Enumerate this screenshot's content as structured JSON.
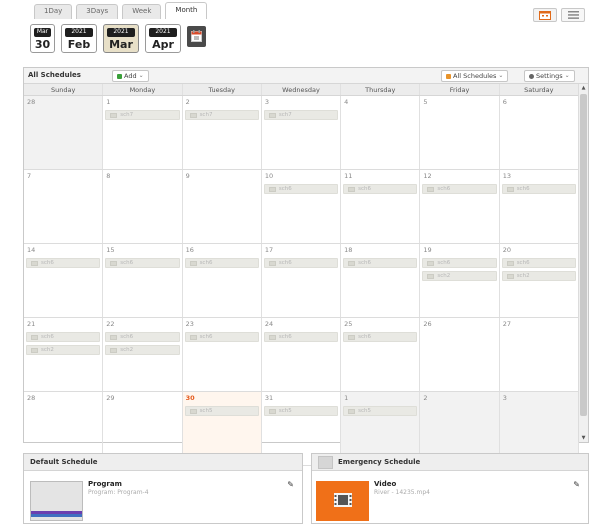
{
  "view_tabs": [
    "1Day",
    "3Days",
    "Week",
    "Month"
  ],
  "active_view": "Month",
  "view_icons": [
    "calendar-view-icon",
    "list-view-icon"
  ],
  "month_nav": [
    {
      "top": "Mar",
      "bottom": "30",
      "kind": "today"
    },
    {
      "top": "2021",
      "bottom": "Feb"
    },
    {
      "top": "2021",
      "bottom": "Mar",
      "selected": true
    },
    {
      "top": "2021",
      "bottom": "Apr"
    }
  ],
  "toolbar": {
    "title": "All Schedules",
    "add_label": "Add",
    "filter_label": "All Schedules",
    "settings_label": "Settings"
  },
  "weekdays": [
    "Sunday",
    "Monday",
    "Tuesday",
    "Wednesday",
    "Thursday",
    "Friday",
    "Saturday"
  ],
  "weeks": [
    [
      {
        "day": "28",
        "gray": true,
        "events": []
      },
      {
        "day": "1",
        "events": [
          "sch7"
        ]
      },
      {
        "day": "2",
        "events": [
          "sch7"
        ]
      },
      {
        "day": "3",
        "events": [
          "sch7"
        ]
      },
      {
        "day": "4",
        "events": []
      },
      {
        "day": "5",
        "events": []
      },
      {
        "day": "6",
        "events": []
      }
    ],
    [
      {
        "day": "7",
        "events": []
      },
      {
        "day": "8",
        "events": []
      },
      {
        "day": "9",
        "events": []
      },
      {
        "day": "10",
        "events": [
          "sch6"
        ]
      },
      {
        "day": "11",
        "events": [
          "sch6"
        ]
      },
      {
        "day": "12",
        "events": [
          "sch6"
        ]
      },
      {
        "day": "13",
        "events": [
          "sch6"
        ]
      }
    ],
    [
      {
        "day": "14",
        "events": [
          "sch6"
        ]
      },
      {
        "day": "15",
        "events": [
          "sch6"
        ]
      },
      {
        "day": "16",
        "events": [
          "sch6"
        ]
      },
      {
        "day": "17",
        "events": [
          "sch6"
        ]
      },
      {
        "day": "18",
        "events": [
          "sch6"
        ]
      },
      {
        "day": "19",
        "events": [
          "sch6",
          "sch2"
        ]
      },
      {
        "day": "20",
        "events": [
          "sch6",
          "sch2"
        ]
      }
    ],
    [
      {
        "day": "21",
        "events": [
          "sch6",
          "sch2"
        ]
      },
      {
        "day": "22",
        "events": [
          "sch6",
          "sch2"
        ]
      },
      {
        "day": "23",
        "events": [
          "sch6"
        ]
      },
      {
        "day": "24",
        "events": [
          "sch6"
        ]
      },
      {
        "day": "25",
        "events": [
          "sch6"
        ]
      },
      {
        "day": "26",
        "events": []
      },
      {
        "day": "27",
        "events": []
      }
    ],
    [
      {
        "day": "28",
        "events": []
      },
      {
        "day": "29",
        "events": []
      },
      {
        "day": "30",
        "today": true,
        "events": [
          "sch5"
        ]
      },
      {
        "day": "31",
        "events": [
          "sch5"
        ]
      },
      {
        "day": "1",
        "gray": true,
        "events": [
          "sch5"
        ]
      },
      {
        "day": "2",
        "gray": true,
        "events": []
      },
      {
        "day": "3",
        "gray": true,
        "events": []
      }
    ]
  ],
  "default_schedule": {
    "header": "Default Schedule",
    "title": "Program",
    "subtitle": "Program: Program-4"
  },
  "emergency_schedule": {
    "header": "Emergency Schedule",
    "title": "Video",
    "subtitle": "River - 14235.mp4"
  },
  "colors": {
    "accent": "#f07018",
    "today_text": "#e55a1c",
    "add_icon": "#3aa03a"
  }
}
